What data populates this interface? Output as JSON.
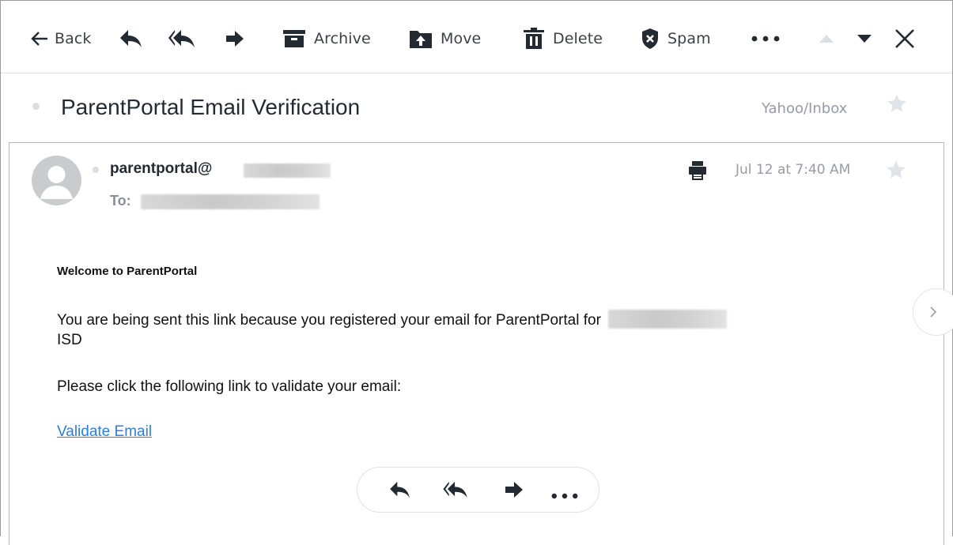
{
  "toolbar": {
    "back_label": "Back",
    "archive_label": "Archive",
    "move_label": "Move",
    "delete_label": "Delete",
    "spam_label": "Spam"
  },
  "message": {
    "subject": "ParentPortal Email Verification",
    "folder": "Yahoo/Inbox",
    "from": "parentportal@",
    "to_label": "To:",
    "date": "Jul 12 at 7:40 AM"
  },
  "body": {
    "welcome": "Welcome to ParentPortal",
    "para1_line1": "You are being sent this link because you registered your email for ParentPortal for",
    "para1_line2": "ISD",
    "para2": "Please click the following link to validate your email:",
    "link_text": "Validate Email"
  },
  "icons": [
    "back-arrow-icon",
    "reply-icon",
    "reply-all-icon",
    "forward-icon",
    "archive-icon",
    "move-icon",
    "delete-icon",
    "spam-icon",
    "more-icon",
    "previous-icon",
    "next-icon",
    "close-icon",
    "star-icon",
    "printer-icon",
    "chevron-right-icon"
  ],
  "colors": {
    "icon": "#232a31",
    "label": "#3d4046",
    "muted": "#979ba7",
    "link": "#2a7de1",
    "star": "#e0e4e9"
  }
}
